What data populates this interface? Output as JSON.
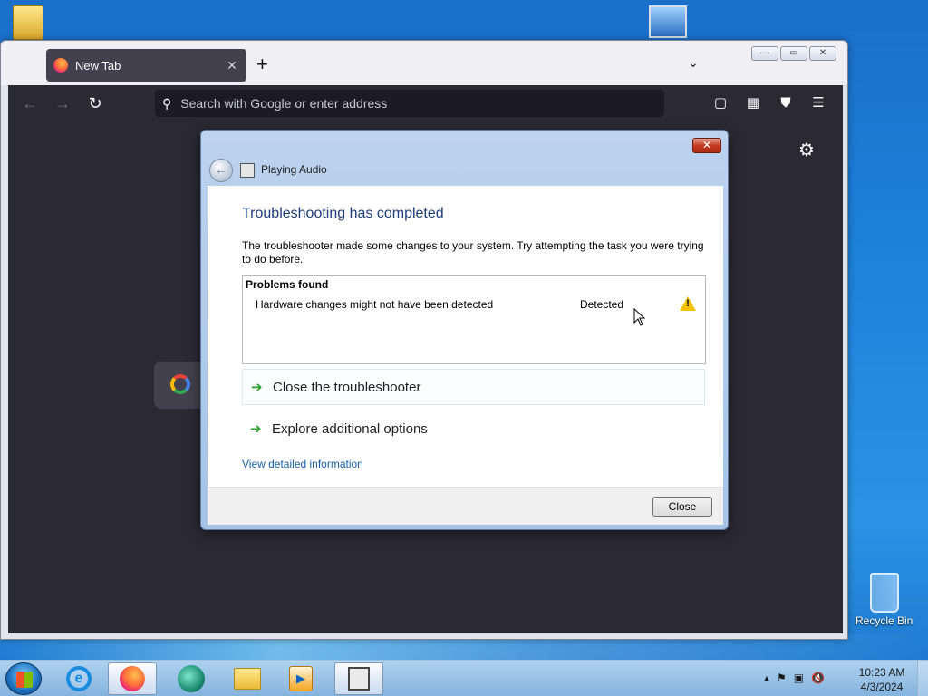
{
  "desktop": {
    "recycle_bin_label": "Recycle Bin"
  },
  "browser": {
    "tab_title": "New Tab",
    "new_tab_symbol": "+",
    "url_placeholder": "Search with Google or enter address"
  },
  "dialog": {
    "app_title": "Playing Audio",
    "heading": "Troubleshooting has completed",
    "description": "The troubleshooter made some changes to your system. Try attempting the task you were trying to do before.",
    "problems_header": "Problems found",
    "problems": [
      {
        "name": "Hardware changes might not have been detected",
        "status": "Detected",
        "icon": "warning-icon"
      }
    ],
    "options": [
      {
        "label": "Close the troubleshooter"
      },
      {
        "label": "Explore additional options"
      }
    ],
    "details_link": "View detailed information",
    "close_button": "Close"
  },
  "taskbar": {
    "time": "10:23 AM",
    "date": "4/3/2024"
  },
  "colors": {
    "dialog_heading": "#1e3c78",
    "link": "#1a5ea8",
    "browser_toolbar": "#2b2a33",
    "warning": "#f2c200"
  }
}
